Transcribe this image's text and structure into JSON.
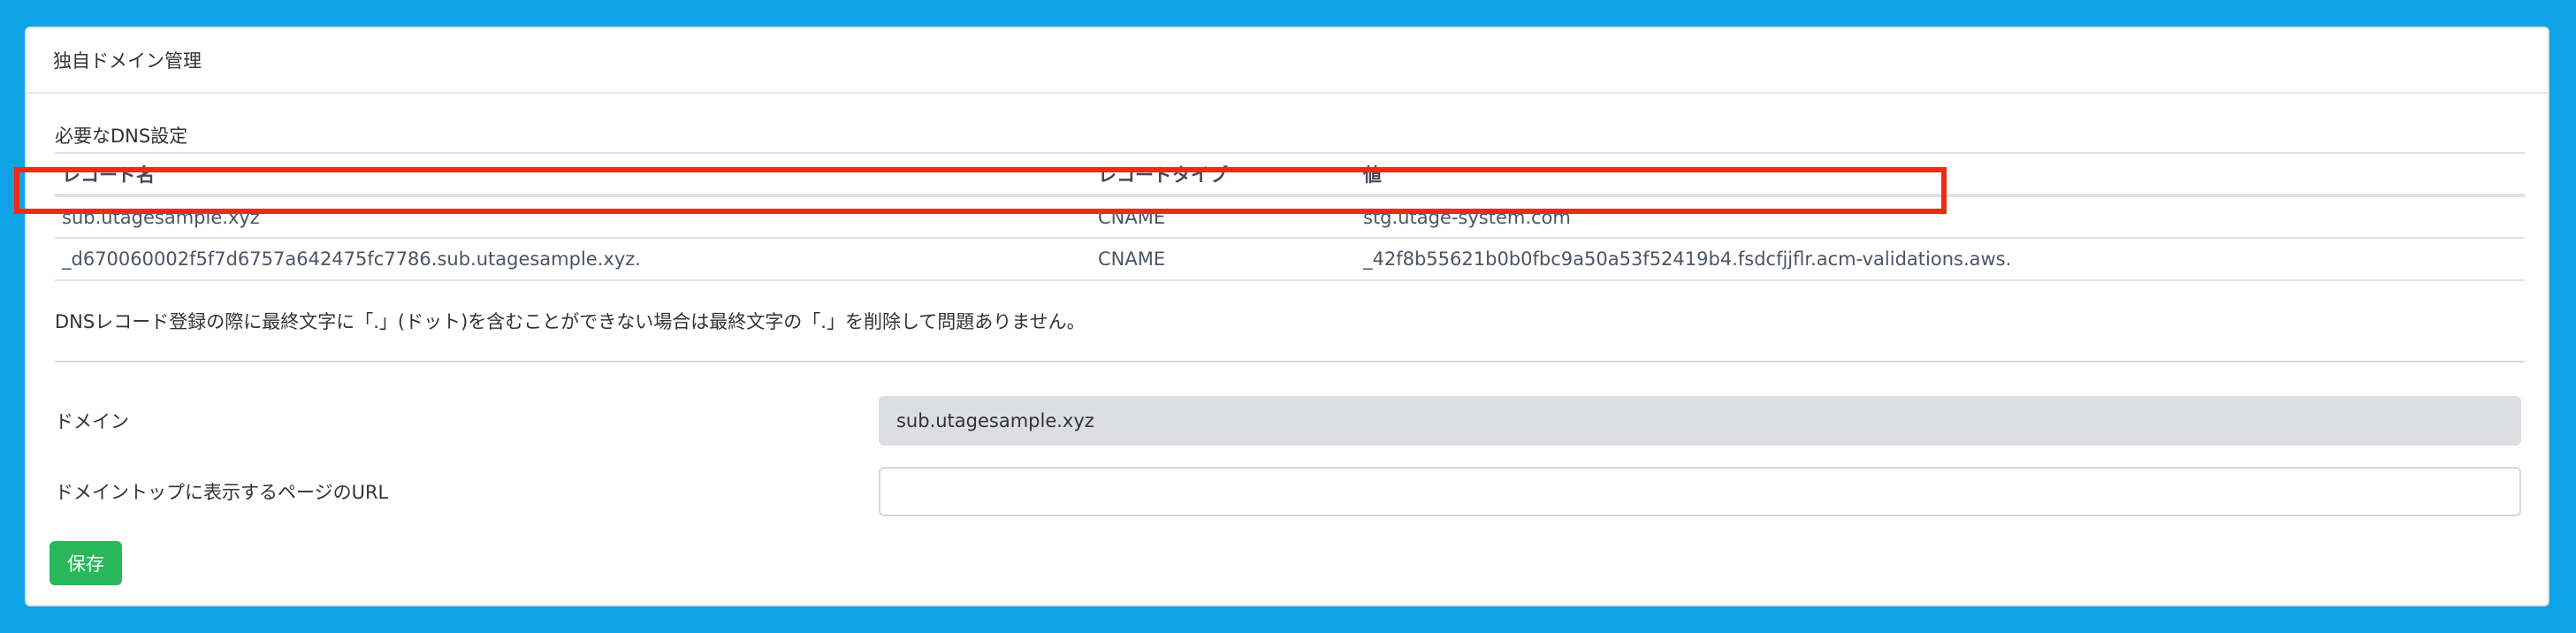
{
  "card": {
    "title": "独自ドメイン管理"
  },
  "dns": {
    "section_title": "必要なDNS設定",
    "columns": [
      "レコード名",
      "レコードタイプ",
      "値"
    ],
    "rows": [
      {
        "name": "sub.utagesample.xyz",
        "type": "CNAME",
        "value": "stg.utage-system.com"
      },
      {
        "name": "_d670060002f5f7d6757a642475fc7786.sub.utagesample.xyz.",
        "type": "CNAME",
        "value": "_42f8b55621b0b0fbc9a50a53f52419b4.fsdcfjjflr.acm-validations.aws."
      }
    ],
    "note": "DNSレコード登録の際に最終文字に「.」(ドット)を含むことができない場合は最終文字の「.」を削除して問題ありません。"
  },
  "form": {
    "domain_label": "ドメイン",
    "domain_value": "sub.utagesample.xyz",
    "url_label": "ドメイントップに表示するページのURL",
    "url_value": "",
    "save_label": "保存"
  },
  "colors": {
    "background": "#0ea2e6",
    "highlight": "#ef2b14",
    "save_button": "#28b85a"
  }
}
